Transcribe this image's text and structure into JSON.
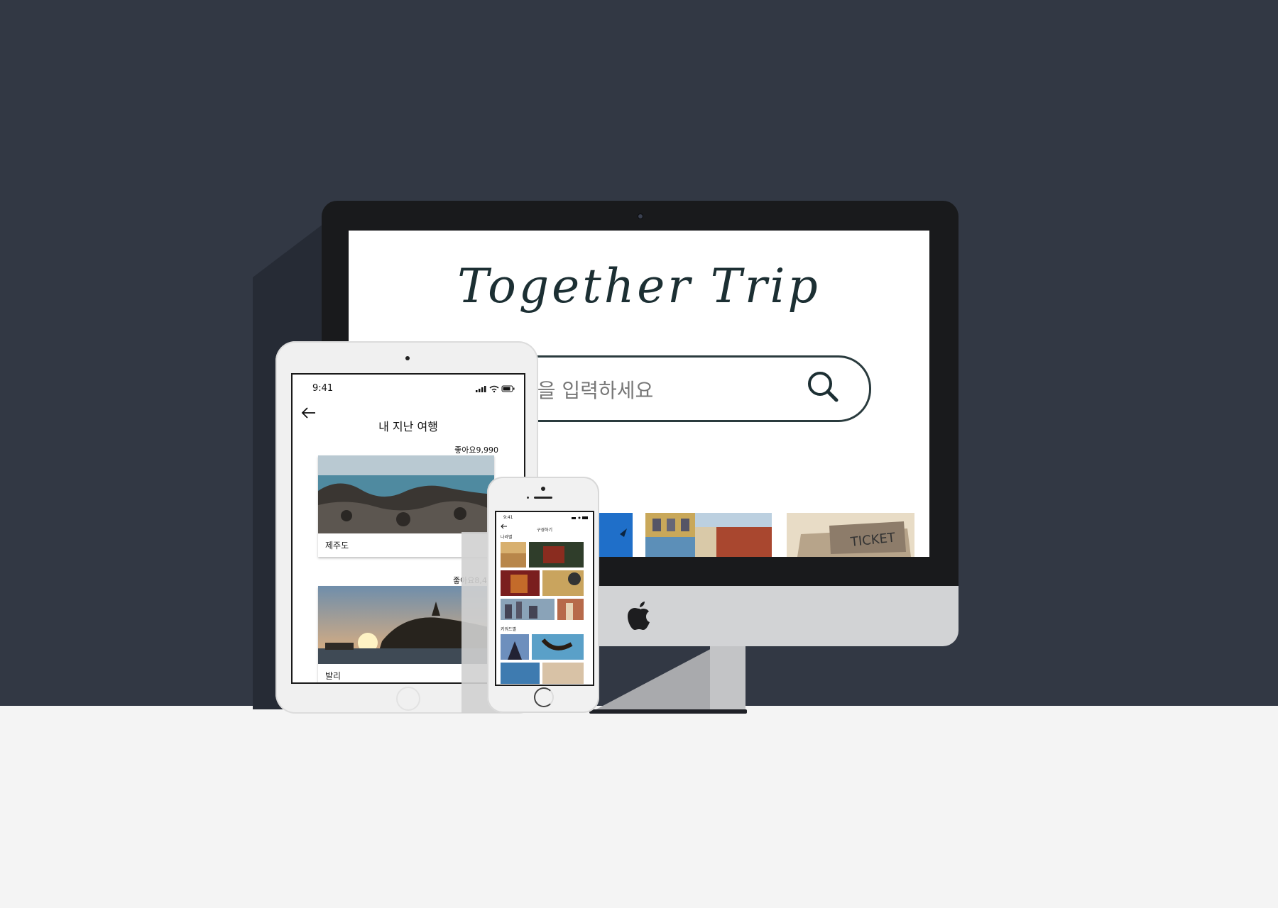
{
  "desktop": {
    "logo_text": "Together Trip",
    "search_placeholder": "등을 입력하세요"
  },
  "tablet": {
    "status_time": "9:41",
    "page_title": "내 지난 여행",
    "cards": [
      {
        "likes": "좋아요9,990",
        "label": "제주도"
      },
      {
        "likes": "좋아요8,4",
        "label": "발리"
      }
    ]
  },
  "phone": {
    "status_time": "9:41",
    "page_title": "구경하기",
    "section_country": "나라별",
    "section_keyword": "키워드별"
  },
  "colors": {
    "background": "#323844",
    "floor": "#f4f4f4",
    "logo": "#1c2f33"
  }
}
